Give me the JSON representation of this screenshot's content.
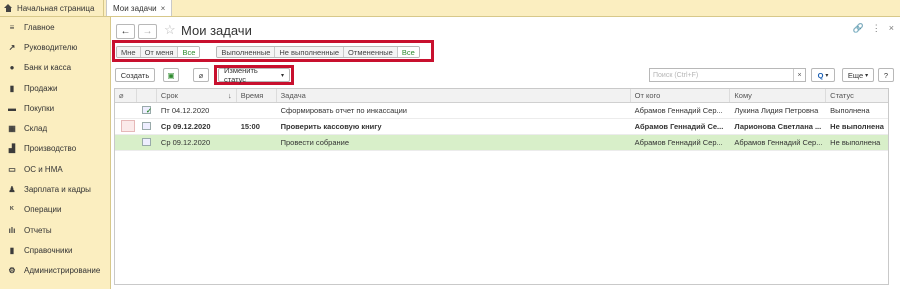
{
  "tabs": {
    "home": "Начальная страница",
    "active": "Мои задачи",
    "close": "×"
  },
  "sidebar": {
    "items": [
      {
        "label": "Главное",
        "icon": "menu-icon"
      },
      {
        "label": "Руководителю",
        "icon": "chart-icon"
      },
      {
        "label": "Банк и касса",
        "icon": "bank-icon"
      },
      {
        "label": "Продажи",
        "icon": "bag-icon"
      },
      {
        "label": "Покупки",
        "icon": "cart-icon"
      },
      {
        "label": "Склад",
        "icon": "warehouse-icon"
      },
      {
        "label": "Производство",
        "icon": "factory-icon"
      },
      {
        "label": "ОС и НМА",
        "icon": "truck-icon"
      },
      {
        "label": "Зарплата и кадры",
        "icon": "person-icon"
      },
      {
        "label": "Операции",
        "icon": "operations-icon"
      },
      {
        "label": "Отчеты",
        "icon": "reports-icon"
      },
      {
        "label": "Справочники",
        "icon": "book-icon"
      },
      {
        "label": "Администрирование",
        "icon": "gear-icon"
      }
    ]
  },
  "header": {
    "back": "←",
    "forward": "→",
    "star": "☆",
    "title": "Мои задачи",
    "link_icon": "🔗",
    "more_icon": "⋮",
    "close_icon": "×"
  },
  "filters": {
    "group1": [
      "Мне",
      "От меня",
      "Все"
    ],
    "group2": [
      "Выполненные",
      "Не выполненные",
      "Отмененные",
      "Все"
    ]
  },
  "toolbar": {
    "create": "Создать",
    "change_status": "Изменить статус",
    "search_placeholder": "Поиск (Ctrl+F)",
    "clear": "×",
    "search_btn": "Q",
    "more": "Еще",
    "help": "?"
  },
  "table": {
    "columns": [
      "",
      "",
      "Срок",
      "↓",
      "Время",
      "Задача",
      "От кого",
      "Кому",
      "Статус"
    ],
    "rows": [
      {
        "date": "Пт 04.12.2020",
        "time": "",
        "task": "Сформировать отчет по инкассации",
        "from": "Абрамов Геннадий Сер...",
        "to": "Лукина Лидия Петровна",
        "status": "Выполнена",
        "style": "normal",
        "done": true
      },
      {
        "date": "Ср 09.12.2020",
        "time": "15:00",
        "task": "Проверить кассовую книгу",
        "from": "Абрамов Геннадий Се...",
        "to": "Ларионова Светлана ...",
        "status": "Не выполнена",
        "style": "bold",
        "done": false
      },
      {
        "date": "Ср 09.12.2020",
        "time": "",
        "task": "Провести собрание",
        "from": "Абрамов Геннадий Сер...",
        "to": "Абрамов Геннадий Сер...",
        "status": "Не выполнена",
        "style": "green",
        "done": false
      }
    ]
  },
  "colors": {
    "sidebar_bg": "#fbeec0",
    "highlight_red": "#c8102e",
    "selected_green": "#2e8b2e",
    "row_green": "#d8efc9"
  }
}
